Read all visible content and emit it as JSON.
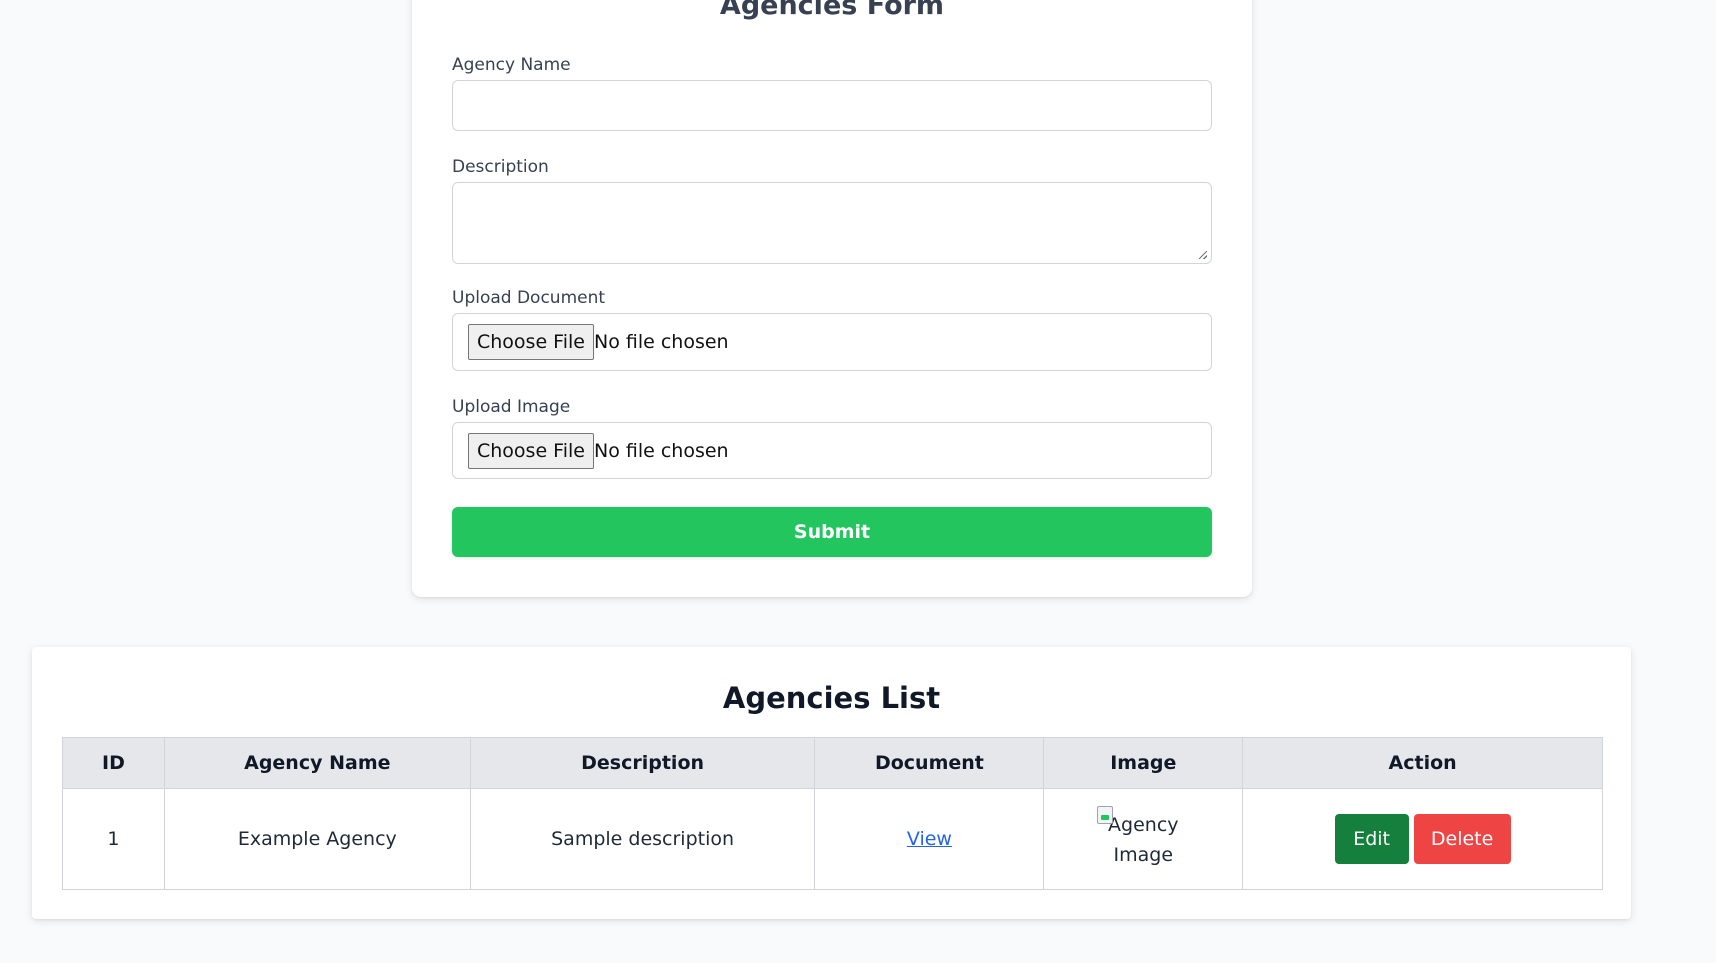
{
  "form": {
    "title": "Agencies Form",
    "agency_name_label": "Agency Name",
    "agency_name_value": "",
    "description_label": "Description",
    "description_value": "",
    "upload_document_label": "Upload Document",
    "upload_image_label": "Upload Image",
    "choose_file_label": "Choose File",
    "no_file_text": "No file chosen",
    "submit_label": "Submit"
  },
  "list": {
    "title": "Agencies List",
    "columns": [
      "ID",
      "Agency Name",
      "Description",
      "Document",
      "Image",
      "Action"
    ],
    "rows": [
      {
        "id": "1",
        "agency_name": "Example Agency",
        "description": "Sample description",
        "document_link": "View",
        "image_alt": "Agency Image",
        "edit_label": "Edit",
        "delete_label": "Delete"
      }
    ]
  },
  "colors": {
    "submit": "#22c55e",
    "edit": "#15803d",
    "delete": "#ef4444",
    "link": "#2563eb"
  }
}
